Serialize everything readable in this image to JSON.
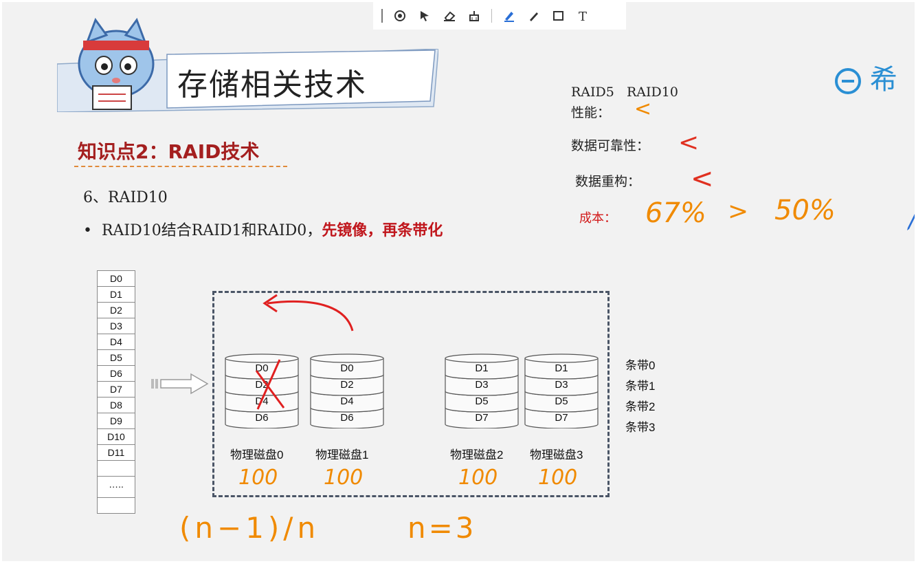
{
  "toolbar": {
    "icons": [
      "laser-pointer-icon",
      "arrow-pointer-icon",
      "eraser-icon",
      "clear-icon",
      "highlighter-icon",
      "pen-icon",
      "rectangle-icon",
      "text-icon"
    ]
  },
  "slide": {
    "title": "存储相关技术",
    "logo_text": "希",
    "knowledge_point": "知识点2：RAID技术",
    "section_no": "6、RAID10",
    "bullet_text": "RAID10结合RAID1和RAID0，",
    "bullet_red": "先镜像，再条带化"
  },
  "comparison": {
    "header": "RAID5   RAID10",
    "performance": "性能：",
    "reliability": "数据可靠性：",
    "rebuild": "数据重构：",
    "cost": "成本："
  },
  "data_blocks": [
    "D0",
    "D1",
    "D2",
    "D3",
    "D4",
    "D5",
    "D6",
    "D7",
    "D8",
    "D9",
    "D10",
    "D11",
    "",
    "…..",
    ""
  ],
  "disks": [
    {
      "label": "物理磁盘0",
      "cells": [
        "D0",
        "D2",
        "D4",
        "D6"
      ],
      "note": "100"
    },
    {
      "label": "物理磁盘1",
      "cells": [
        "D0",
        "D2",
        "D4",
        "D6"
      ],
      "note": "100"
    },
    {
      "label": "物理磁盘2",
      "cells": [
        "D1",
        "D3",
        "D5",
        "D7"
      ],
      "note": "100"
    },
    {
      "label": "物理磁盘3",
      "cells": [
        "D1",
        "D3",
        "D5",
        "D7"
      ],
      "note": "100"
    }
  ],
  "stripes": [
    "条带0",
    "条带1",
    "条带2",
    "条带3"
  ],
  "handwriting": {
    "less1": "<",
    "less2": "<",
    "less3": "<",
    "cost_raid5": "67%",
    "gt": ">",
    "cost_raid10": "50%",
    "formula": "(n−1)/n",
    "n_value": "n=3"
  },
  "colors": {
    "title_red": "#a41f1f",
    "accent_orange": "#f08a00",
    "logo_blue": "#2a8fd4"
  }
}
